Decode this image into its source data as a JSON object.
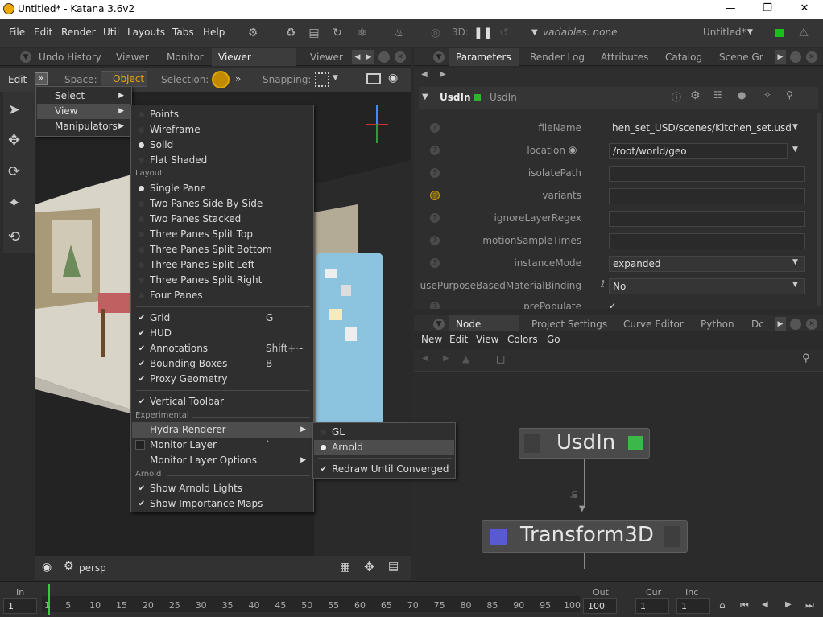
{
  "window": {
    "title": "Untitled* - Katana 3.6v2"
  },
  "menubar": {
    "items": [
      "File",
      "Edit",
      "Render",
      "Util",
      "Layouts",
      "Tabs",
      "Help"
    ],
    "mode_3d": "3D:",
    "variables": "variables: none",
    "project": "Untitled*"
  },
  "left_tabs": [
    "Undo History",
    "Viewer",
    "Monitor",
    "Viewer (Hydra)",
    "Viewer"
  ],
  "right_top_tabs": [
    "Parameters",
    "Render Log",
    "Attributes",
    "Catalog",
    "Scene Gr"
  ],
  "viewer_toolbar": {
    "edit": "Edit",
    "space_label": "Space:",
    "space_value": "Object",
    "selection_label": "Selection:",
    "snapping_label": "Snapping:"
  },
  "viewer_bottom": {
    "camera": "persp"
  },
  "edit_menu": {
    "items": [
      "Select",
      "View",
      "Manipulators"
    ]
  },
  "view_menu": {
    "shading": [
      "Points",
      "Wireframe",
      "Solid",
      "Flat Shaded"
    ],
    "layout_header": "Layout",
    "layouts": [
      "Single Pane",
      "Two Panes Side By Side",
      "Two Panes Stacked",
      "Three Panes Split Top",
      "Three Panes Split Bottom",
      "Three Panes Split Left",
      "Three Panes Split Right",
      "Four Panes"
    ],
    "toggles": [
      {
        "label": "Grid",
        "shortcut": "G"
      },
      {
        "label": "HUD",
        "shortcut": ""
      },
      {
        "label": "Annotations",
        "shortcut": "Shift+~"
      },
      {
        "label": "Bounding Boxes",
        "shortcut": "B"
      },
      {
        "label": "Proxy Geometry",
        "shortcut": ""
      }
    ],
    "vertical_toolbar": "Vertical Toolbar",
    "experimental_header": "Experimental",
    "hydra_renderer": "Hydra Renderer",
    "monitor_layer": "Monitor Layer",
    "monitor_layer_shortcut": "`",
    "monitor_layer_options": "Monitor Layer Options",
    "arnold_header": "Arnold",
    "arnold_items": [
      "Show Arnold Lights",
      "Show Importance Maps"
    ]
  },
  "hydra_menu": {
    "items": [
      "GL",
      "Arnold"
    ],
    "redraw": "Redraw Until Converged"
  },
  "params": {
    "node_type": "UsdIn",
    "node_name": "UsdIn",
    "rows": [
      {
        "label": "fileName",
        "value": "hen_set_USD/scenes/Kitchen_set.usd"
      },
      {
        "label": "location",
        "value": "/root/world/geo"
      },
      {
        "label": "isolatePath",
        "value": ""
      },
      {
        "label": "variants",
        "value": ""
      },
      {
        "label": "ignoreLayerRegex",
        "value": ""
      },
      {
        "label": "motionSampleTimes",
        "value": ""
      },
      {
        "label": "instanceMode",
        "value": "expanded"
      },
      {
        "label": "usePurposeBasedMaterialBinding",
        "value": "No"
      },
      {
        "label": "prePopulate",
        "value": "✓"
      }
    ]
  },
  "node_graph": {
    "tabs": [
      "Node Graph",
      "Project Settings",
      "Curve Editor",
      "Python",
      "Dc"
    ],
    "menu": [
      "New",
      "Edit",
      "View",
      "Colors",
      "Go"
    ],
    "nodes": [
      "UsdIn",
      "Transform3D"
    ],
    "port_label": "in"
  },
  "timeline": {
    "in_label": "In",
    "in_value": "1",
    "ticks": [
      "1",
      "5",
      "10",
      "15",
      "20",
      "25",
      "30",
      "35",
      "40",
      "45",
      "50",
      "55",
      "60",
      "65",
      "70",
      "75",
      "80",
      "85",
      "90",
      "95",
      "100"
    ],
    "out_label": "Out",
    "out_value": "100",
    "cur_label": "Cur",
    "cur_value": "1",
    "inc_label": "Inc",
    "inc_value": "1"
  }
}
